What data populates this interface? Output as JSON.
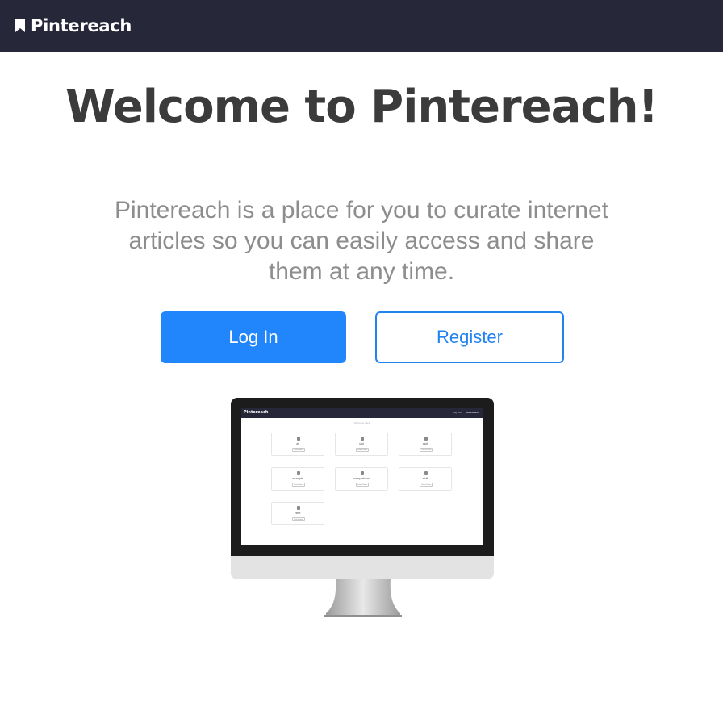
{
  "navbar": {
    "brand_text": "Pintereach",
    "brand_icon": "bookmark-icon",
    "background": "#262739"
  },
  "hero": {
    "title": "Welcome to Pintereach!",
    "description": "Pintereach is a place for you to curate internet articles so you can easily access and share them at any time."
  },
  "actions": {
    "login_label": "Log In",
    "register_label": "Register",
    "accent": "#2185fb"
  },
  "preview": {
    "brand_text": "Pintereach",
    "nav_login": "Log Out",
    "nav_dashboard": "Dashboard",
    "subtitle": "Welcome back!",
    "boards": [
      {
        "name": "all",
        "button": "Delete Board"
      },
      {
        "name": "sad",
        "button": "Delete Board"
      },
      {
        "name": "asdf",
        "button": "Delete Board"
      },
      {
        "name": "example",
        "button": "Delete Board"
      },
      {
        "name": "exampleboard",
        "button": "Delete Board"
      },
      {
        "name": "stuff",
        "button": "Delete Board"
      },
      {
        "name": "here",
        "button": "Delete Board"
      }
    ]
  }
}
